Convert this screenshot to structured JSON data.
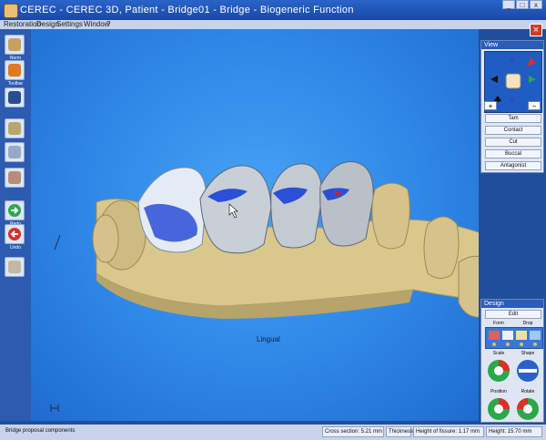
{
  "window": {
    "title": "CEREC - CEREC 3D, Patient - Bridge01 - Bridge - Biogeneric Function",
    "close_symbol": "×"
  },
  "menu": {
    "items": [
      "Restoration",
      "Design",
      "Settings",
      "Window",
      "?"
    ]
  },
  "toolbar": {
    "labels": [
      "Norm",
      "Toolbar",
      "",
      "",
      "",
      "",
      "Redo",
      "Undo",
      ""
    ]
  },
  "view_panel": {
    "title": "View",
    "zoom_in": "+",
    "zoom_out": "−",
    "buttons": [
      "Tam",
      "Contact",
      "Cut",
      "Buccal",
      "Antagonist"
    ]
  },
  "design_panel": {
    "title": "Design",
    "edit_label": "Edit",
    "tool_labels": [
      "Form",
      "Drop"
    ],
    "group_labels": [
      "Scale",
      "Shape",
      "Position",
      "Rotate"
    ]
  },
  "viewport": {
    "orientation_label": "Lingual"
  },
  "status": {
    "left": "Bridge proposal components",
    "cross_section": "Cross section: 5.21 mm",
    "thickness": "Thickness",
    "height_of_fissure": "Height of fissure: 1.17 mm",
    "height": "Height: 15.70 mm"
  },
  "colors": {
    "viewport_bg": "#2e86e6",
    "model_base": "#d9c88c",
    "crown": "#dfe6ee",
    "contact": "#2b4fd6"
  }
}
